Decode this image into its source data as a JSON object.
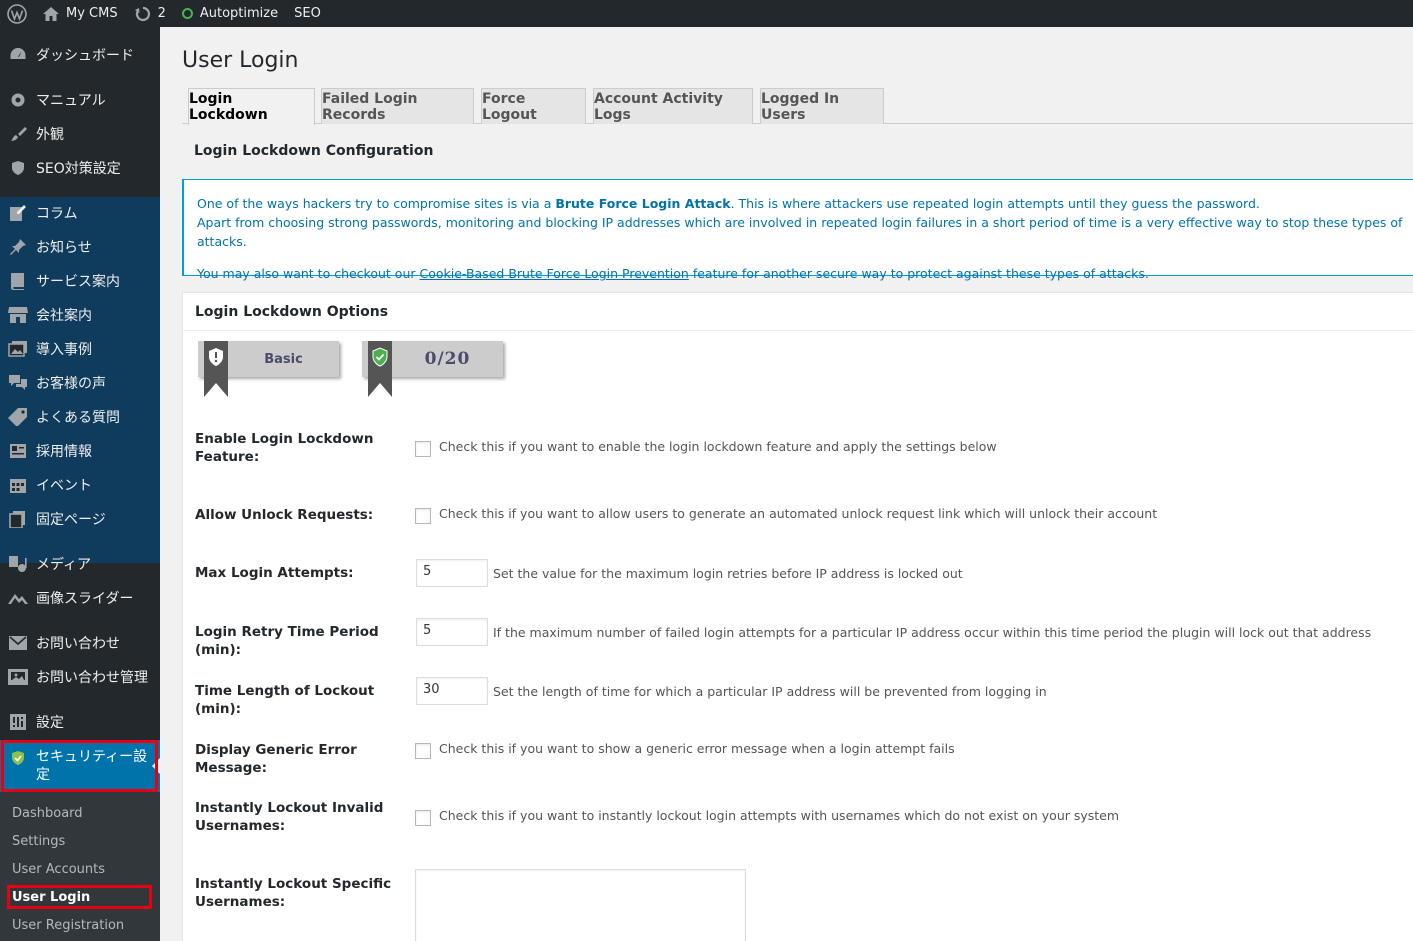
{
  "adminbar": {
    "site_name": "My CMS",
    "updates_count": "2",
    "autoptimize": "Autoptimize",
    "seo": "SEO"
  },
  "sidebar": {
    "items": [
      {
        "label": "ダッシュボード",
        "icon": "dashboard-icon"
      },
      {
        "label": "マニュアル",
        "icon": "gear-icon"
      },
      {
        "label": "外観",
        "icon": "paintbrush-icon"
      },
      {
        "label": "SEO対策設定",
        "icon": "shield-icon"
      },
      {
        "label": "コラム",
        "icon": "edit-icon"
      },
      {
        "label": "お知らせ",
        "icon": "pin-icon"
      },
      {
        "label": "サービス案内",
        "icon": "book-icon"
      },
      {
        "label": "会社案内",
        "icon": "store-icon"
      },
      {
        "label": "導入事例",
        "icon": "images-icon"
      },
      {
        "label": "お客様の声",
        "icon": "testimonial-icon"
      },
      {
        "label": "よくある質問",
        "icon": "tag-icon"
      },
      {
        "label": "採用情報",
        "icon": "id-card-icon"
      },
      {
        "label": "イベント",
        "icon": "calendar-icon"
      },
      {
        "label": "固定ページ",
        "icon": "page-icon"
      },
      {
        "label": "メディア",
        "icon": "media-icon"
      },
      {
        "label": "画像スライダー",
        "icon": "slider-icon"
      },
      {
        "label": "お問い合わせ",
        "icon": "mail-icon"
      },
      {
        "label": "お問い合わせ管理",
        "icon": "inbox-icon"
      },
      {
        "label": "設定",
        "icon": "settings-icon"
      }
    ],
    "active": {
      "label": "セキュリティー設定",
      "icon": "security-shield-icon"
    },
    "submenu": [
      "Dashboard",
      "Settings",
      "User Accounts",
      "User Login",
      "User Registration"
    ]
  },
  "page": {
    "title": "User Login",
    "tabs": [
      "Login Lockdown",
      "Failed Login Records",
      "Force Logout",
      "Account Activity Logs",
      "Logged In Users"
    ],
    "section_title": "Login Lockdown Configuration"
  },
  "notice": {
    "line1_pre": "One of the ways hackers try to compromise sites is via a ",
    "line1_bold": "Brute Force Login Attack",
    "line1_post": ". This is where attackers use repeated login attempts until they guess the password.",
    "line2": "Apart from choosing strong passwords, monitoring and blocking IP addresses which are involved in repeated login failures in a short period of time is a very effective way to stop these types of attacks.",
    "line3_pre": "You may also want to checkout our ",
    "line3_link": "Cookie-Based Brute Force Login Prevention",
    "line3_post": " feature for another secure way to protect against these types of attacks."
  },
  "options": {
    "title": "Login Lockdown Options",
    "badge_level": "Basic",
    "badge_score": "0/20",
    "enable_label": "Enable Login Lockdown Feature:",
    "enable_desc": "Check this if you want to enable the login lockdown feature and apply the settings below",
    "unlock_label": "Allow Unlock Requests:",
    "unlock_desc": "Check this if you want to allow users to generate an automated unlock request link which will unlock their account",
    "max_label": "Max Login Attempts:",
    "max_value": "5",
    "max_desc": "Set the value for the maximum login retries before IP address is locked out",
    "retry_label": "Login Retry Time Period (min):",
    "retry_value": "5",
    "retry_desc": "If the maximum number of failed login attempts for a particular IP address occur within this time period the plugin will lock out that address",
    "lockout_label": "Time Length of Lockout (min):",
    "lockout_value": "30",
    "lockout_desc": "Set the length of time for which a particular IP address will be prevented from logging in",
    "generic_label": "Display Generic Error Message:",
    "generic_desc": "Check this if you want to show a generic error message when a login attempt fails",
    "invalid_label": "Instantly Lockout Invalid Usernames:",
    "invalid_desc": "Check this if you want to instantly lockout login attempts with usernames which do not exist on your system",
    "specific_label": "Instantly Lockout Specific Usernames:"
  }
}
